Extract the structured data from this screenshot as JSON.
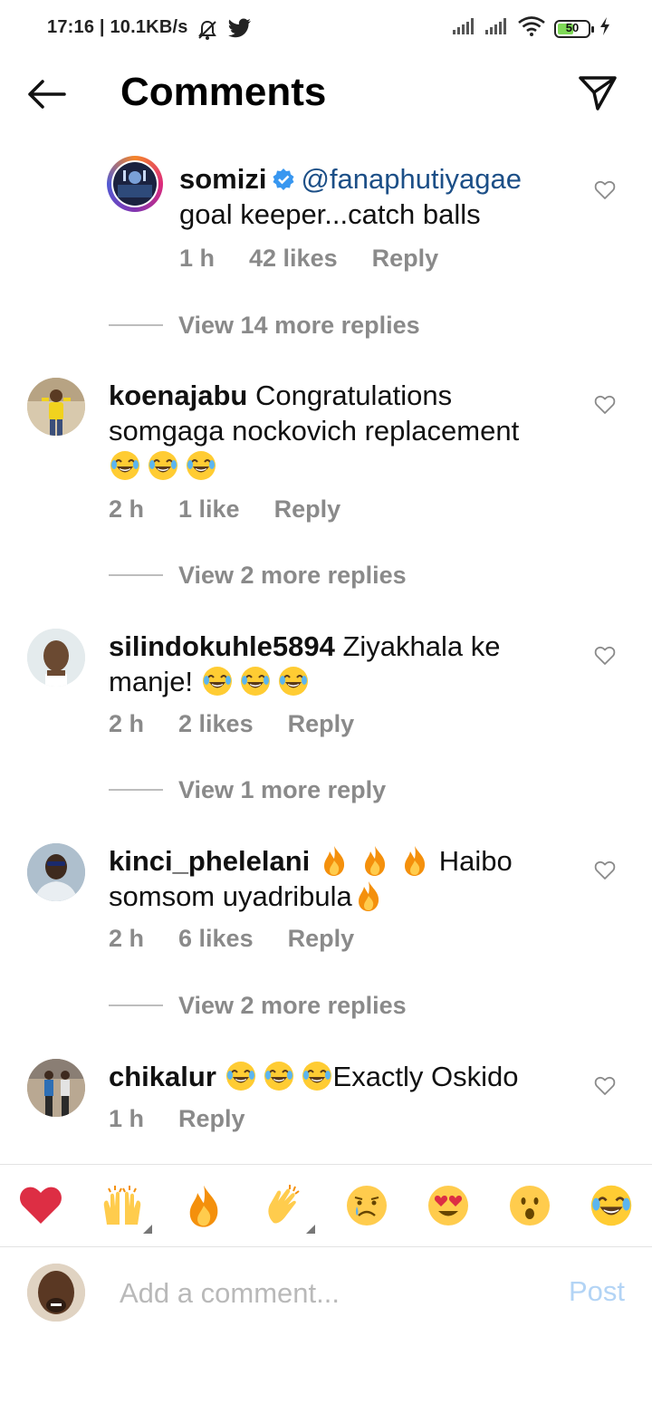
{
  "status_bar": {
    "time_info": "17:16 | 10.1KB/s",
    "battery_level": "50",
    "icons": [
      "mute-icon",
      "twitter-icon",
      "signal-icon",
      "wifi-icon",
      "battery-icon",
      "charging-icon"
    ]
  },
  "header": {
    "title": "Comments",
    "back_icon": "back-arrow-icon",
    "share_icon": "send-icon"
  },
  "comments": [
    {
      "user": "somizi",
      "verified": true,
      "mention": "@fanaphutiyagae",
      "text": "goal keeper...catch balls",
      "time": "1 h",
      "likes": "42 likes",
      "reply": "Reply",
      "view_more": "View 14 more replies"
    },
    {
      "user": "koenajabu",
      "text_line1": "Congratulations",
      "text_line2": "somgaga nockovich replacement",
      "emojis": [
        "joy-emoji",
        "joy-emoji",
        "joy-emoji"
      ],
      "time": "2 h",
      "likes": "1 like",
      "reply": "Reply",
      "view_more": "View 2 more replies"
    },
    {
      "user": "silindokuhle5894",
      "text_line1": "Ziyakhala ke",
      "text_line2": "manje!",
      "emojis": [
        "joy-emoji",
        "joy-emoji",
        "joy-emoji"
      ],
      "time": "2 h",
      "likes": "2 likes",
      "reply": "Reply",
      "view_more": "View 1 more reply"
    },
    {
      "user": "kinci_phelelani",
      "emojis": [
        "fire-emoji",
        "fire-emoji",
        "fire-emoji",
        "fire-emoji"
      ],
      "text_line1": "Haibo",
      "text_line2": "somsom uyadribula",
      "time": "2 h",
      "likes": "6 likes",
      "reply": "Reply",
      "view_more": "View 2 more replies"
    },
    {
      "user": "chikalur",
      "emojis": [
        "joy-emoji",
        "joy-emoji",
        "joy-emoji"
      ],
      "text": "Exactly Oskido",
      "time": "1 h",
      "reply": "Reply"
    }
  ],
  "quick_reactions": [
    "red-heart-emoji",
    "raising-hands-emoji",
    "fire-emoji",
    "clapping-hands-emoji",
    "crying-face-emoji",
    "heart-eyes-emoji",
    "surprised-face-emoji",
    "joy-emoji"
  ],
  "composer": {
    "placeholder": "Add a comment...",
    "post_label": "Post"
  },
  "colors": {
    "mention": "#1c4f87",
    "meta_gray": "#8a8a8a",
    "post_disabled": "#b3d4f5",
    "verified_blue": "#3897f0"
  }
}
